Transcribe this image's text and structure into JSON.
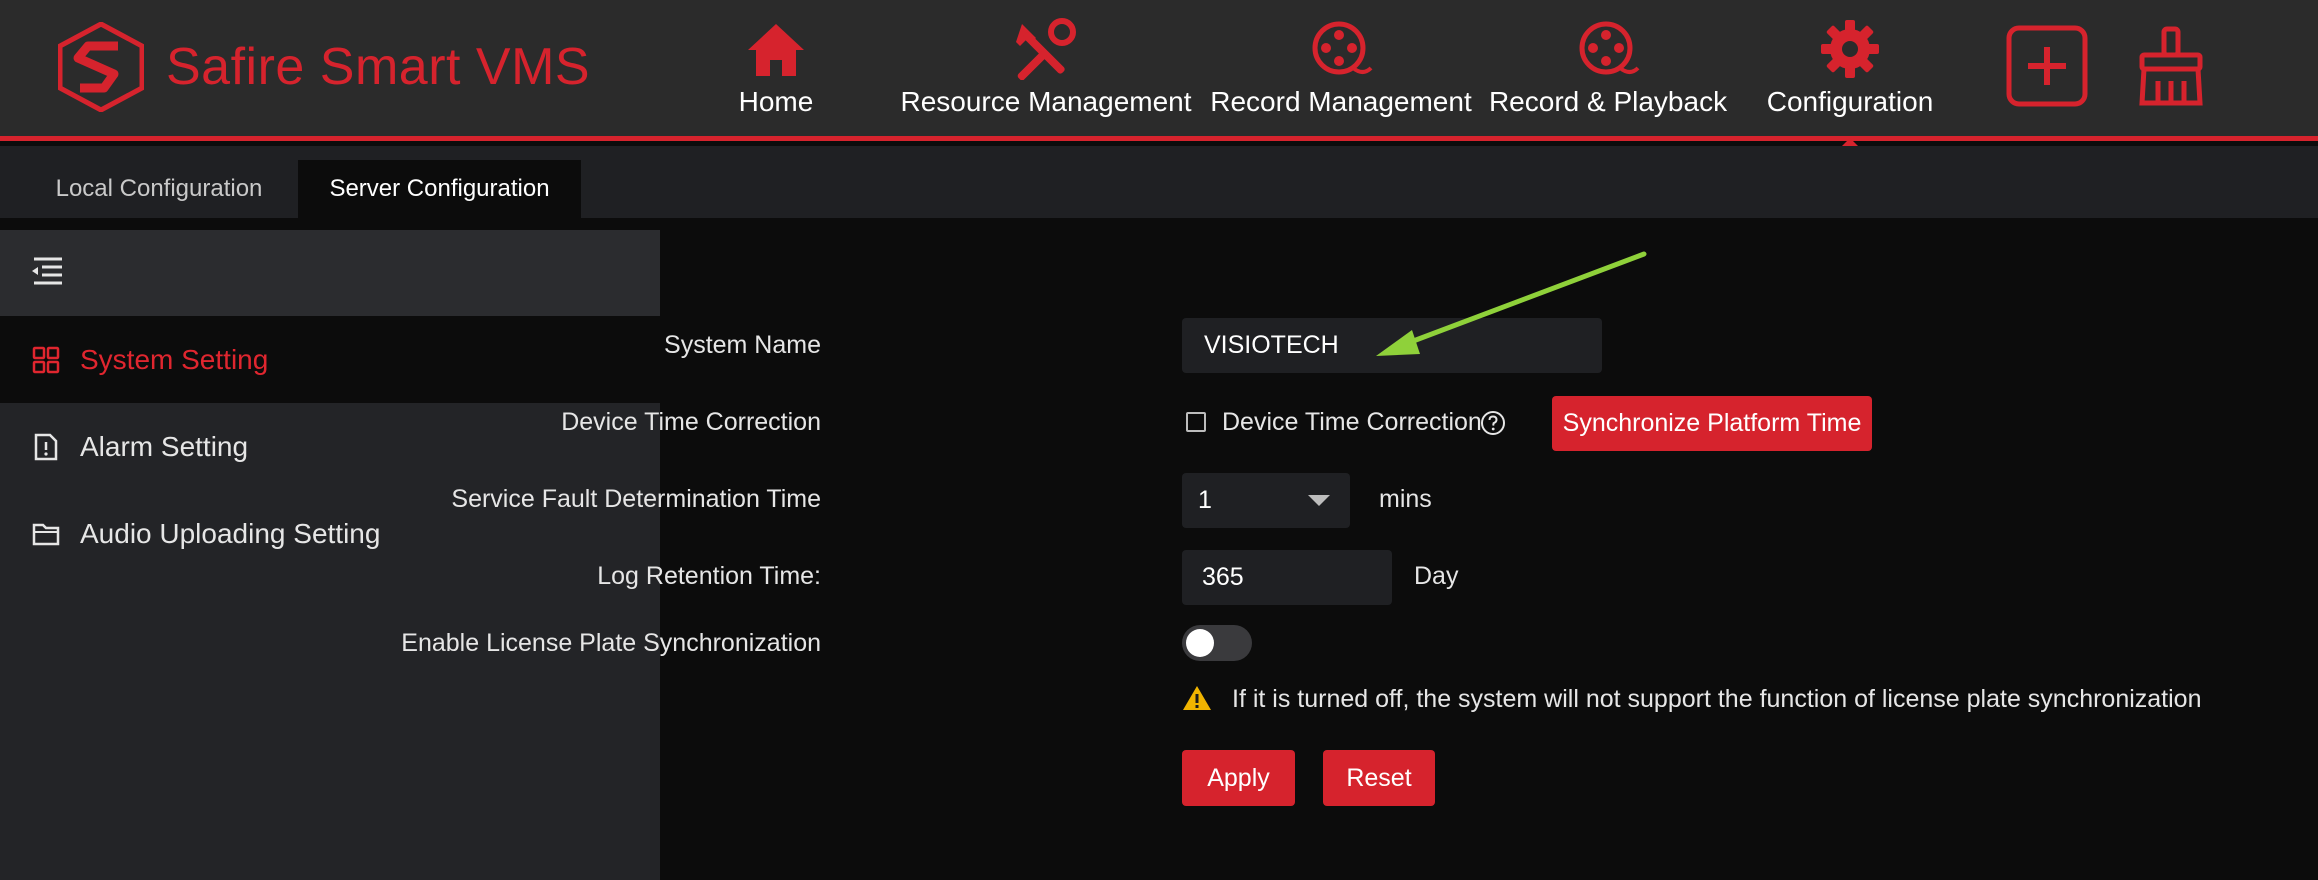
{
  "app": {
    "title": "Safire Smart VMS",
    "brand_color": "#d6232d"
  },
  "nav": {
    "items": [
      {
        "label": "Home",
        "icon": "home-icon"
      },
      {
        "label": "Resource Management",
        "icon": "tools-icon"
      },
      {
        "label": "Record Management",
        "icon": "film-reel-icon"
      },
      {
        "label": "Record & Playback",
        "icon": "film-reel-icon"
      },
      {
        "label": "Configuration",
        "icon": "gear-icon",
        "active": true
      }
    ],
    "tools": [
      {
        "icon": "plus-square-icon"
      },
      {
        "icon": "broom-icon"
      }
    ]
  },
  "tabs": [
    {
      "label": "Local Configuration",
      "active": false
    },
    {
      "label": "Server Configuration",
      "active": true
    }
  ],
  "sidebar": {
    "items": [
      {
        "label": "System Setting",
        "icon": "grid-icon",
        "active": true
      },
      {
        "label": "Alarm Setting",
        "icon": "alert-document-icon"
      },
      {
        "label": "Audio Uploading Setting",
        "icon": "folder-icon"
      }
    ]
  },
  "form": {
    "system_name": {
      "label": "System Name",
      "value": "VISIOTECH"
    },
    "device_time": {
      "label": "Device Time Correction",
      "checkbox_label": "Device Time Correction",
      "checked": false,
      "sync_button": "Synchronize Platform Time"
    },
    "fault_time": {
      "label": "Service Fault Determination Time",
      "value": "1",
      "unit": "mins"
    },
    "log_retention": {
      "label": "Log Retention Time:",
      "value": "365",
      "unit": "Day"
    },
    "license_plate": {
      "label": "Enable License Plate Synchronization",
      "enabled": false,
      "warning": "If it is turned off, the system will not support the function of license plate synchronization"
    },
    "apply_label": "Apply",
    "reset_label": "Reset"
  }
}
